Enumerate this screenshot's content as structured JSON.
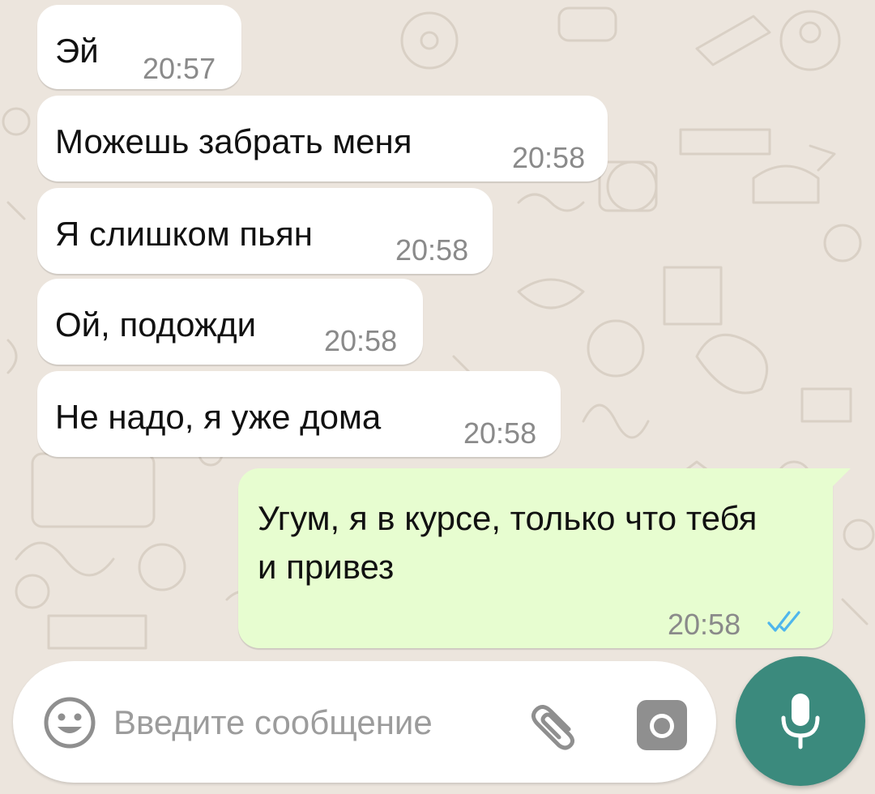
{
  "messages": [
    {
      "direction": "incoming",
      "text": "Эй",
      "time": "20:57"
    },
    {
      "direction": "incoming",
      "text": "Можешь забрать меня",
      "time": "20:58"
    },
    {
      "direction": "incoming",
      "text": "Я слишком пьян",
      "time": "20:58"
    },
    {
      "direction": "incoming",
      "text": "Ой, подожди",
      "time": "20:58"
    },
    {
      "direction": "incoming",
      "text": "Не надо, я уже дома",
      "time": "20:58"
    },
    {
      "direction": "outgoing",
      "text": "Угум, я в курсе, только что тебя и привез",
      "time": "20:58",
      "status": "read",
      "status_icon": "double-check-icon"
    }
  ],
  "composer": {
    "placeholder": "Введите сообщение",
    "emoji_icon": "emoji-icon",
    "attach_icon": "paperclip-icon",
    "camera_icon": "camera-icon",
    "send_icon": "microphone-icon"
  },
  "colors": {
    "wallpaper": "#ece5dd",
    "incoming_bubble": "#ffffff",
    "outgoing_bubble": "#e7fdd0",
    "read_ticks": "#4fb6ec",
    "mic_button": "#3b8a7d",
    "timestamp": "#8a8a8a"
  }
}
